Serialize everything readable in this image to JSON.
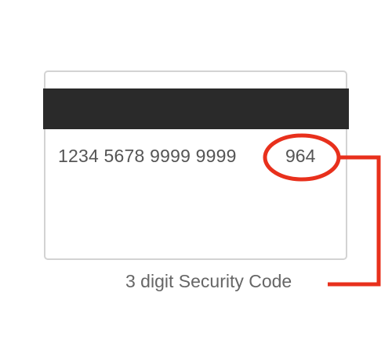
{
  "card": {
    "number": "1234 5678 9999 9999",
    "security_code": "964"
  },
  "caption": "3 digit Security Code",
  "colors": {
    "highlight": "#e8301c",
    "stripe": "#2a2a2a",
    "card_border": "#d3d3d3",
    "text": "#555555"
  }
}
